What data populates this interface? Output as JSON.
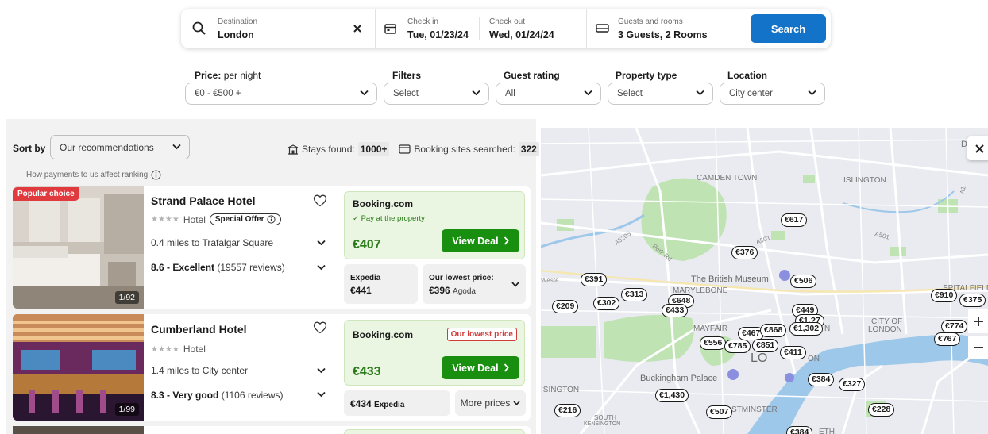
{
  "search": {
    "destination_label": "Destination",
    "destination_value": "London",
    "checkin_label": "Check in",
    "checkin_value": "Tue, 01/23/24",
    "checkout_label": "Check out",
    "checkout_value": "Wed, 01/24/24",
    "guests_label": "Guests and rooms",
    "guests_value": "3 Guests, 2 Rooms",
    "search_button": "Search"
  },
  "filters": {
    "price_label": "Price:",
    "price_sub": " per night",
    "price_value": "€0 - €500 +",
    "filters_label": "Filters",
    "filters_value": "Select",
    "guest_rating_label": "Guest rating",
    "guest_rating_value": "All",
    "property_type_label": "Property type",
    "property_type_value": "Select",
    "location_label": "Location",
    "location_value": "City center"
  },
  "results": {
    "sort_label": "Sort by",
    "sort_value": "Our recommendations",
    "stays_label": "Stays found:",
    "stays_count": "1000+",
    "sites_label": "Booking sites searched:",
    "sites_count": "322",
    "ranking_note": "How payments to us affect ranking"
  },
  "hotels": [
    {
      "badge": "Popular choice",
      "name": "Strand Palace Hotel",
      "stars": "★★★★",
      "type": "Hotel",
      "offer": "Special Offer",
      "distance": "0.4 miles to Trafalgar Square",
      "rating_score": "8.6 - Excellent",
      "rating_reviews": " (19557 reviews)",
      "photo_count": "1/92",
      "deal_site": "Booking.com",
      "deal_note": "✓ Pay at the property",
      "deal_price": "€407",
      "view_deal": "View Deal",
      "alt_site": "Expedia",
      "alt_price": "€441",
      "lowest_label": "Our lowest price:",
      "lowest_price": "€396",
      "lowest_site": "Agoda"
    },
    {
      "name": "Cumberland Hotel",
      "stars": "★★★★",
      "type": "Hotel",
      "distance": "1.4 miles to City center",
      "rating_score": "8.3 - Very good",
      "rating_reviews": " (1106 reviews)",
      "photo_count": "1/99",
      "deal_site": "Booking.com",
      "deal_tag": "Our lowest price",
      "deal_price": "€433",
      "view_deal": "View Deal",
      "alt_price": "€434",
      "alt_site": "Expedia",
      "more_prices": "More prices"
    }
  ],
  "map": {
    "areas": [
      "CAMDEN TOWN",
      "ISLINGTON",
      "MARYLEBONE",
      "MAYFAIR",
      "CITY OF",
      "LONDON",
      "SOUTH",
      "KENSINGTON",
      "DALS",
      "SPITALFIELD",
      "ISINGTON",
      "STMINSTER",
      "ETH",
      "LO",
      "N",
      "ON"
    ],
    "pois": [
      "The British Museum",
      "Buckingham Palace"
    ],
    "roads": [
      "A5205",
      "Park Rd",
      "A501",
      "A501",
      "Weste",
      "A1"
    ],
    "prices": [
      "€617",
      "€376",
      "€391",
      "€506",
      "€313",
      "€648",
      "€433",
      "€209",
      "€302",
      "€449",
      "€910",
      "€375",
      "€467",
      "€868",
      "€1,302",
      "€774",
      "€767",
      "€556",
      "€785",
      "€851",
      "€411",
      "€384",
      "€327",
      "€1,430",
      "€216",
      "€507",
      "€228",
      "€384",
      "€",
      "€1,?7"
    ]
  },
  "colors": {
    "accent_blue": "#1373c8",
    "deal_green": "#198f0f",
    "popular_red": "#e0393e"
  }
}
